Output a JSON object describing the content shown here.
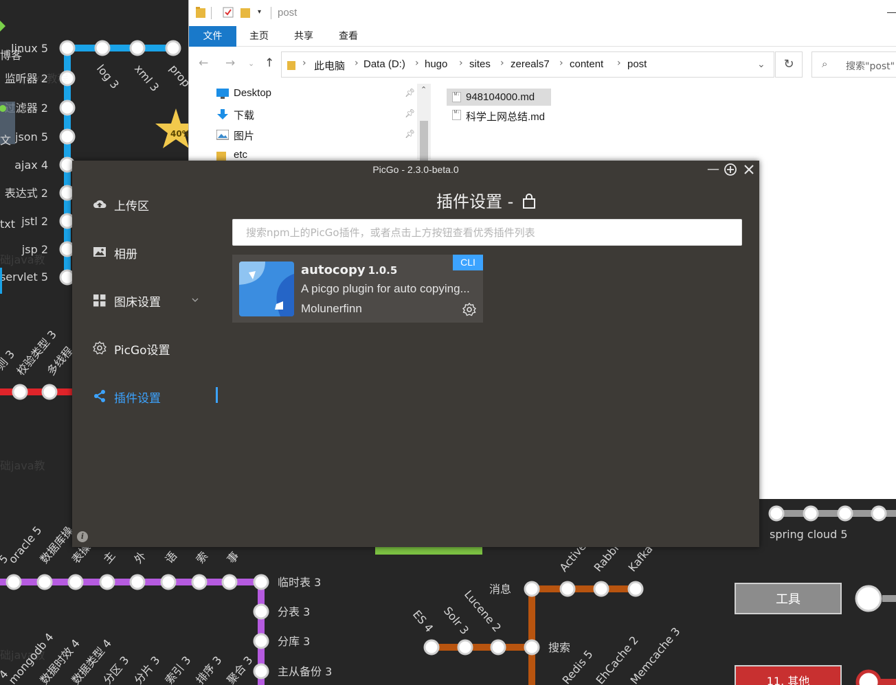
{
  "background_map": {
    "left_labels": [
      "linux 5",
      "监听器 2",
      "过滤器 2",
      "json 5",
      "ajax 4",
      "表达式 2",
      "jstl 2",
      "jsp 2",
      "servlet 5"
    ],
    "edge_fragments": [
      "博客",
      "文",
      "txt"
    ],
    "top_diagonal": [
      "log 3",
      "xml 3",
      "prop"
    ],
    "star_badge": "40%",
    "mid_diagonal": [
      "校验类型 3",
      "多线程",
      "则 3"
    ],
    "watermarks": [
      "础java教程",
      "础java教",
      "础java教",
      "础java教"
    ],
    "lower_diagonal": [
      "oracle 5",
      "数据库操",
      "表操",
      "主",
      "外",
      "语",
      "索",
      "事",
      "5"
    ],
    "purple_labels": [
      "临时表 3",
      "分表 3",
      "分库 3",
      "主从备份 3"
    ],
    "bottom_diagonal": [
      "mongodb 4",
      "数据时效 4",
      "数据类型 4",
      "分区 3",
      "分片 3",
      "索引 3",
      "排序 3",
      "聚合 3",
      "4"
    ],
    "right_labels": [
      "spring cloud 5",
      "消息",
      "搜索"
    ],
    "mq_diagonal": [
      "Active",
      "Rabbi",
      "Kafka"
    ],
    "search_diagonal": [
      "ES 4",
      "Solr 3",
      "Lucene 2"
    ],
    "cache_diagonal": [
      "Redis 5",
      "EhCache 2",
      "Memcache 3"
    ],
    "tool_box": "工具",
    "other_box": "11. 其他"
  },
  "explorer": {
    "title": "post",
    "ribbon_tabs": [
      "文件",
      "主页",
      "共享",
      "查看"
    ],
    "breadcrumbs": [
      "此电脑",
      "Data (D:)",
      "hugo",
      "sites",
      "zereals7",
      "content",
      "post"
    ],
    "search_placeholder": "搜索\"post\"",
    "nav_items": [
      "Desktop",
      "下载",
      "图片",
      "etc"
    ],
    "files": [
      "948104000.md",
      "科学上网总结.md"
    ]
  },
  "picgo": {
    "title": "PicGo - 2.3.0-beta.0",
    "sidebar": [
      "上传区",
      "相册",
      "图床设置",
      "PicGo设置",
      "插件设置"
    ],
    "page_title": "插件设置 -",
    "search_placeholder": "搜索npm上的PicGo插件，或者点击上方按钮查看优秀插件列表",
    "plugin": {
      "name": "autocopy",
      "version": "1.0.5",
      "description": "A picgo plugin for auto copying...",
      "author": "Molunerfinn",
      "badge": "CLI"
    }
  },
  "colors": {
    "accent": "#3ca3ff",
    "ribbon_active": "#1979ca",
    "picgo_bg": "#3d3a36",
    "map_blue": "#1aa3e8",
    "map_red": "#e0242a",
    "map_purple": "#b65be0",
    "map_brown": "#b8540f"
  }
}
